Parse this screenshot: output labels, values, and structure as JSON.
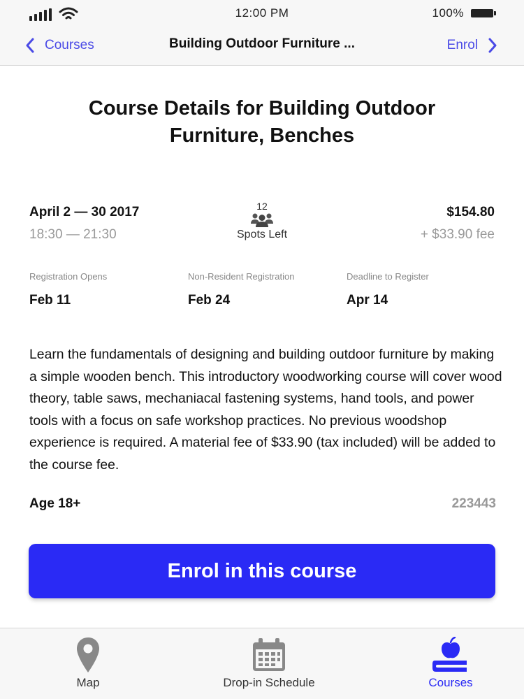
{
  "status_bar": {
    "time": "12:00 PM",
    "battery_percent": "100%",
    "icons": [
      "signal-icon",
      "wifi-icon",
      "battery-icon"
    ]
  },
  "nav": {
    "back_label": "Courses",
    "title": "Building Outdoor Furniture ...",
    "forward_label": "Enrol",
    "accent_color": "#4a4ae6"
  },
  "course": {
    "title": "Course Details for Building Outdoor Furniture, Benches",
    "date_range": "April 2 — 30 2017",
    "time_range": "18:30 — 21:30",
    "spots_count": "12",
    "spots_label": "Spots Left",
    "price": "$154.80",
    "fee": "+ $33.90 fee",
    "dates": [
      {
        "label": "Registration Opens",
        "value": "Feb 11"
      },
      {
        "label": "Non-Resident Registration",
        "value": "Feb 24"
      },
      {
        "label": "Deadline to Register",
        "value": "Apr 14"
      }
    ],
    "description": "Learn the fundamentals of designing and building outdoor furniture by making a simple wooden bench. This introductory woodworking course will cover wood theory, table saws, mechaniacal fastening systems, hand tools, and power tools with a focus on safe workshop practices. No previous woodshop experience is required. A material fee of $33.90 (tax included) will be added to the course fee.",
    "age": "Age 18+",
    "course_id": "223443"
  },
  "enrol_button": {
    "label": "Enrol in this course",
    "color": "#2a2af5"
  },
  "tab_bar": {
    "tabs": [
      {
        "label": "Map",
        "icon": "map-pin-icon",
        "active": false
      },
      {
        "label": "Drop-in Schedule",
        "icon": "calendar-icon",
        "active": false
      },
      {
        "label": "Courses",
        "icon": "apple-books-icon",
        "active": true
      }
    ]
  }
}
